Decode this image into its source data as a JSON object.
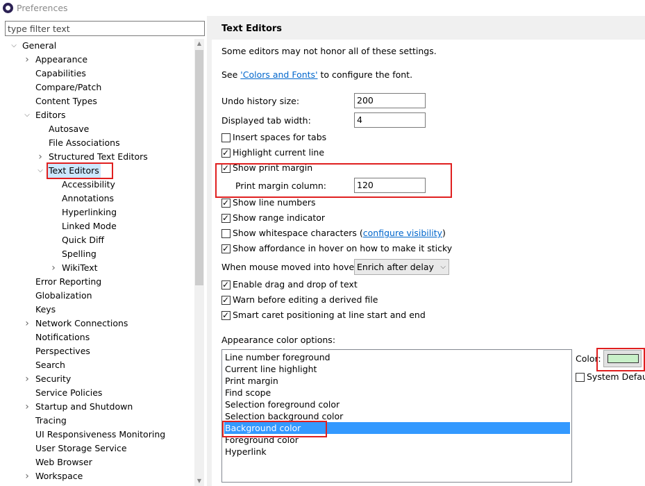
{
  "window": {
    "title": "Preferences"
  },
  "filter": {
    "placeholder": "type filter text"
  },
  "tree": [
    {
      "label": "General",
      "expanded": true
    },
    {
      "label": "Appearance",
      "expandable": true
    },
    {
      "label": "Capabilities"
    },
    {
      "label": "Compare/Patch"
    },
    {
      "label": "Content Types"
    },
    {
      "label": "Editors",
      "expanded": true
    },
    {
      "label": "Autosave"
    },
    {
      "label": "File Associations"
    },
    {
      "label": "Structured Text Editors",
      "expandable": true
    },
    {
      "label": "Text Editors",
      "expanded": true,
      "selected": true
    },
    {
      "label": "Accessibility"
    },
    {
      "label": "Annotations"
    },
    {
      "label": "Hyperlinking"
    },
    {
      "label": "Linked Mode"
    },
    {
      "label": "Quick Diff"
    },
    {
      "label": "Spelling"
    },
    {
      "label": "WikiText",
      "expandable": true
    },
    {
      "label": "Error Reporting"
    },
    {
      "label": "Globalization"
    },
    {
      "label": "Keys"
    },
    {
      "label": "Network Connections",
      "expandable": true
    },
    {
      "label": "Notifications"
    },
    {
      "label": "Perspectives"
    },
    {
      "label": "Search"
    },
    {
      "label": "Security",
      "expandable": true
    },
    {
      "label": "Service Policies"
    },
    {
      "label": "Startup and Shutdown",
      "expandable": true
    },
    {
      "label": "Tracing"
    },
    {
      "label": "UI Responsiveness Monitoring"
    },
    {
      "label": "User Storage Service"
    },
    {
      "label": "Web Browser"
    },
    {
      "label": "Workspace",
      "expandable": true
    }
  ],
  "page": {
    "title": "Text Editors",
    "note": "Some editors may not honor all of these settings.",
    "see_prefix": "See ",
    "see_link": "'Colors and Fonts'",
    "see_suffix": " to configure the font.",
    "undo_label": "Undo history size:",
    "undo_value": "200",
    "tab_label": "Displayed tab width:",
    "tab_value": "4",
    "insert_spaces": {
      "label": "Insert spaces for tabs",
      "checked": false
    },
    "highlight_line": {
      "label": "Highlight current line",
      "checked": true
    },
    "print_margin": {
      "label": "Show print margin",
      "checked": true
    },
    "print_margin_col_label": "Print margin column:",
    "print_margin_col_value": "120",
    "line_numbers": {
      "label": "Show line numbers",
      "checked": true
    },
    "range_indicator": {
      "label": "Show range indicator",
      "checked": true
    },
    "whitespace": {
      "label": "Show whitespace characters (",
      "link": "configure visibility",
      "suffix": ")",
      "checked": false
    },
    "affordance": {
      "label": "Show affordance in hover on how to make it sticky",
      "checked": true
    },
    "hover_label": "When mouse moved into hover:",
    "hover_value": "Enrich after delay",
    "drag_drop": {
      "label": "Enable drag and drop of text",
      "checked": true
    },
    "warn_derived": {
      "label": "Warn before editing a derived file",
      "checked": true
    },
    "smart_caret": {
      "label": "Smart caret positioning at line start and end",
      "checked": true
    },
    "appearance_label": "Appearance color options:",
    "color_options": [
      "Line number foreground",
      "Current line highlight",
      "Print margin",
      "Find scope",
      "Selection foreground color",
      "Selection background color",
      "Background color",
      "Foreground color",
      "Hyperlink"
    ],
    "selected_color_option": "Background color",
    "color_label": "Color:",
    "color_value": "#c8f0c8",
    "system_default": {
      "label": "System Default",
      "checked": false
    }
  },
  "highlight_color": "#e01f1f"
}
